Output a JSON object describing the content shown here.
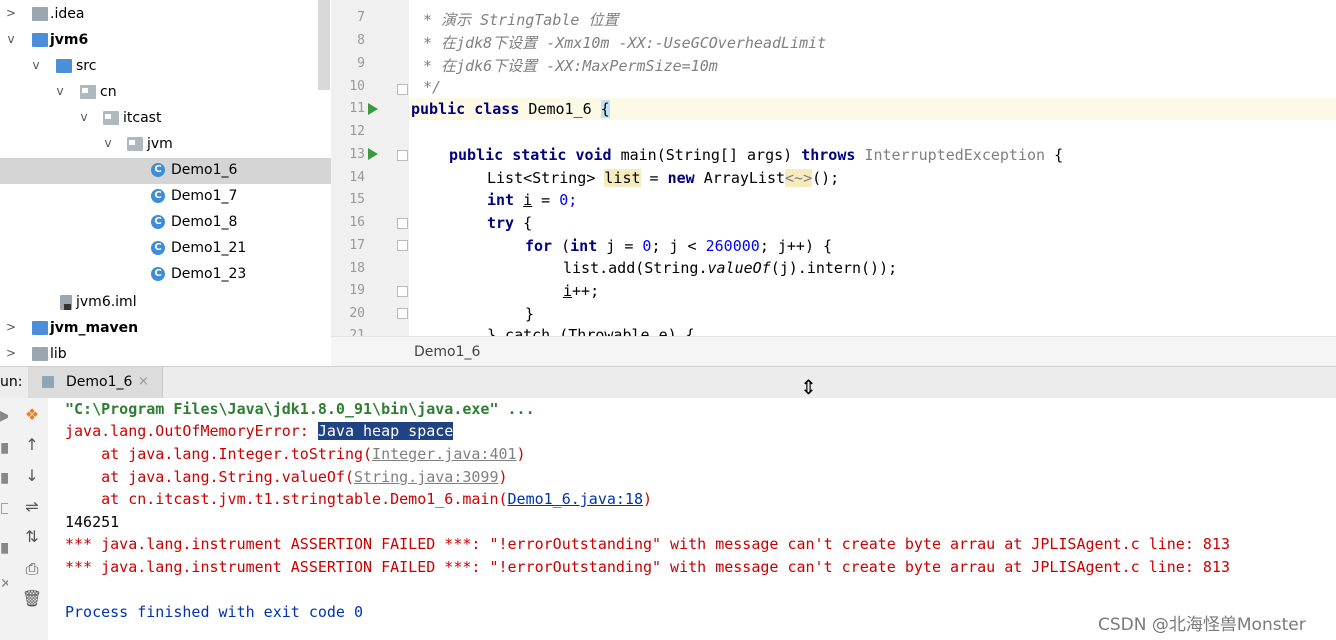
{
  "tree": {
    "items": [
      {
        "label": ".idea",
        "arrow": ">",
        "bold": false
      },
      {
        "label": "jvm6",
        "arrow": "v",
        "bold": true
      },
      {
        "label": "src",
        "arrow": "v",
        "bold": false
      },
      {
        "label": "cn",
        "arrow": "v",
        "bold": false
      },
      {
        "label": "itcast",
        "arrow": "v",
        "bold": false
      },
      {
        "label": "jvm",
        "arrow": "v",
        "bold": false
      },
      {
        "label": "Demo1_6",
        "arrow": "",
        "bold": false
      },
      {
        "label": "Demo1_7",
        "arrow": "",
        "bold": false
      },
      {
        "label": "Demo1_8",
        "arrow": "",
        "bold": false
      },
      {
        "label": "Demo1_21",
        "arrow": "",
        "bold": false
      },
      {
        "label": "Demo1_23",
        "arrow": "",
        "bold": false
      },
      {
        "label": "jvm6.iml",
        "arrow": "",
        "bold": false
      },
      {
        "label": "jvm_maven",
        "arrow": ">",
        "bold": true
      },
      {
        "label": "lib",
        "arrow": ">",
        "bold": false
      }
    ],
    "class_icon_letter": "C"
  },
  "editor": {
    "line_numbers": [
      "7",
      "8",
      "9",
      "10",
      "11",
      "12",
      "13",
      "14",
      "15",
      "16",
      "17",
      "18",
      "19",
      "20",
      "21"
    ],
    "comments": {
      "l7": "* 演示 StringTable 位置",
      "l8": "* 在jdk8下设置 -Xmx10m -XX:-UseGCOverheadLimit",
      "l9": "* 在jdk6下设置 -XX:MaxPermSize=10m",
      "l10": "*/"
    },
    "tokens": {
      "public": "public",
      "class": "class",
      "class_name": "Demo1_6",
      "open_brace": "{",
      "static": "static",
      "void": "void",
      "main_sig": "main(String[] args)",
      "throws": "throws",
      "exception": "InterruptedException",
      "list_type": "List<String>",
      "list_var": "list",
      "assign": " = ",
      "new": "new",
      "array_list": "ArrayList",
      "diamond": "<~>",
      "paren_end": "();",
      "int": "int",
      "i_var": "i",
      "zero_semicolon": "0;",
      "eq": " = ",
      "try": "try",
      "for": "for",
      "for_mid": "j = ",
      "for_zero": "0",
      "for_cond": "; j < ",
      "for_limit": "260000",
      "for_end": "; j++) {",
      "for_open": " (",
      "add_start": "list.add(String.",
      "value_of": "valueOf",
      "add_end": "(j).intern());",
      "increment": "++;",
      "close_brace": "}",
      "catch_line": "} catch (Throwable e) {"
    },
    "breadcrumb": "Demo1_6"
  },
  "run": {
    "label": "un:",
    "tab_label": "Demo1_6",
    "tab_close": "×",
    "cursor_glyph": "⇕"
  },
  "console": {
    "cmd": "\"C:\\Program Files\\Java\\jdk1.8.0_91\\bin\\java.exe\" ...",
    "error_prefix": "java.lang.OutOfMemoryError: ",
    "error_selected": "Java heap space",
    "trace1_prefix": "    at java.lang.Integer.toString(",
    "trace1_link": "Integer.java:401",
    "trace1_suffix": ")",
    "trace2_prefix": "    at java.lang.String.valueOf(",
    "trace2_link": "String.java:3099",
    "trace2_suffix": ")",
    "trace3_prefix": "    at cn.itcast.jvm.t1.stringtable.Demo1_6.main(",
    "trace3_link": "Demo1_6.java:18",
    "trace3_suffix": ")",
    "count": "146251",
    "assert1": "*** java.lang.instrument ASSERTION FAILED ***: \"!errorOutstanding\" with message can't create byte arrau at JPLISAgent.c line: 813",
    "assert2": "*** java.lang.instrument ASSERTION FAILED ***: \"!errorOutstanding\" with message can't create byte arrau at JPLISAgent.c line: 813",
    "finished": "Process finished with exit code 0"
  },
  "tools": {
    "up": "↑",
    "down": "↓",
    "wrap": "⇌",
    "sort": "⇅",
    "print": "⎙",
    "trash": "🗑",
    "logo": "❖"
  },
  "watermark": "CSDN @北海怪兽Monster"
}
